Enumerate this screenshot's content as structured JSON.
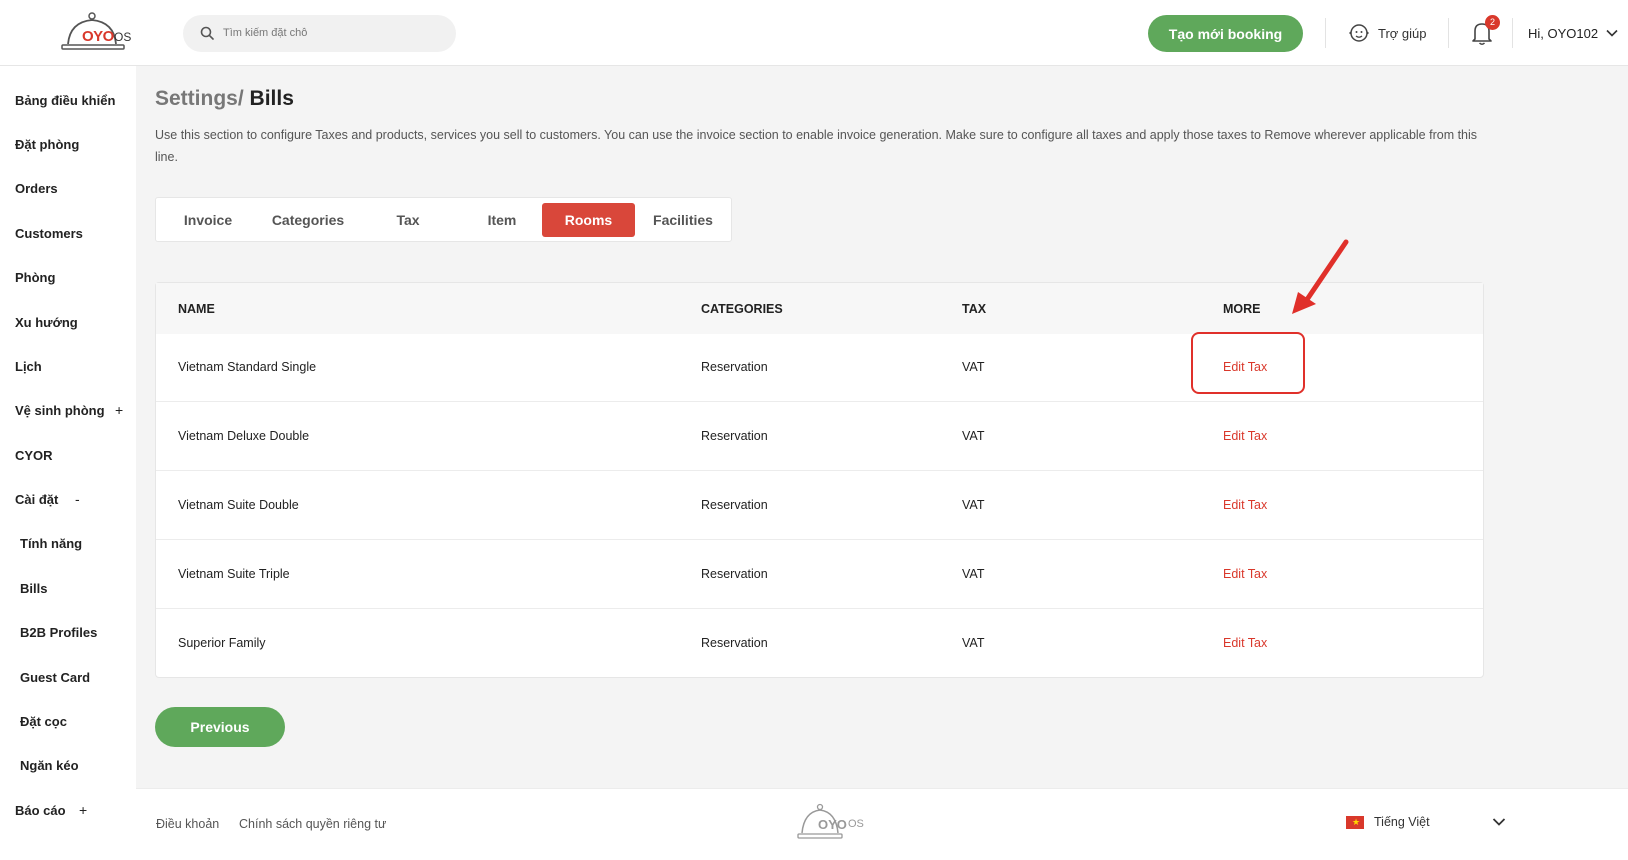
{
  "header": {
    "brand": "OYO",
    "brand_suffix": "OS",
    "search_placeholder": "Tìm kiếm đặt chỗ",
    "create_booking_label": "Tạo mới booking",
    "help_label": "Trợ giúp",
    "notification_count": "2",
    "user_greeting": "Hi, OYO102"
  },
  "sidebar": {
    "items": [
      {
        "label": "Bảng điều khiển"
      },
      {
        "label": "Đặt phòng"
      },
      {
        "label": "Orders"
      },
      {
        "label": "Customers"
      },
      {
        "label": "Phòng"
      },
      {
        "label": "Xu hướng"
      },
      {
        "label": "Lịch"
      },
      {
        "label": "Vệ sinh phòng",
        "mark": "+"
      },
      {
        "label": "CYOR"
      },
      {
        "label": "Cài đặt",
        "mark": "-"
      },
      {
        "label": "Tính năng"
      },
      {
        "label": "Bills"
      },
      {
        "label": "B2B Profiles"
      },
      {
        "label": "Guest Card"
      },
      {
        "label": "Đặt cọc"
      },
      {
        "label": "Ngăn kéo"
      },
      {
        "label": "Báo cáo",
        "mark": "+"
      }
    ]
  },
  "page": {
    "breadcrumb_parent": "Settings/",
    "breadcrumb_current": "Bills",
    "description": "Use this section to configure Taxes and products, services you sell to customers. You can use the invoice section to enable invoice generation. Make sure to configure all taxes and apply those taxes to Remove wherever applicable from this line."
  },
  "tabs": [
    {
      "label": "Invoice",
      "active": false
    },
    {
      "label": "Categories",
      "active": false
    },
    {
      "label": "Tax",
      "active": false
    },
    {
      "label": "Item",
      "active": false
    },
    {
      "label": "Rooms",
      "active": true
    },
    {
      "label": "Facilities",
      "active": false
    }
  ],
  "table": {
    "columns": [
      "NAME",
      "CATEGORIES",
      "TAX",
      "MORE"
    ],
    "rows": [
      {
        "name": "Vietnam Standard Single",
        "category": "Reservation",
        "tax": "VAT",
        "action": "Edit Tax"
      },
      {
        "name": "Vietnam Deluxe Double",
        "category": "Reservation",
        "tax": "VAT",
        "action": "Edit Tax"
      },
      {
        "name": "Vietnam Suite Double",
        "category": "Reservation",
        "tax": "VAT",
        "action": "Edit Tax"
      },
      {
        "name": "Vietnam Suite Triple",
        "category": "Reservation",
        "tax": "VAT",
        "action": "Edit Tax"
      },
      {
        "name": "Superior Family",
        "category": "Reservation",
        "tax": "VAT",
        "action": "Edit Tax"
      }
    ]
  },
  "pagination": {
    "previous_label": "Previous"
  },
  "footer": {
    "terms_label": "Điều khoản",
    "privacy_label": "Chính sách quyền riêng tư",
    "brand": "OYO",
    "brand_suffix": "OS",
    "language_label": "Tiếng Việt"
  },
  "colors": {
    "brand_red": "#d9382b",
    "primary_green": "#5fa85b",
    "annotation_red": "#e0302a"
  }
}
